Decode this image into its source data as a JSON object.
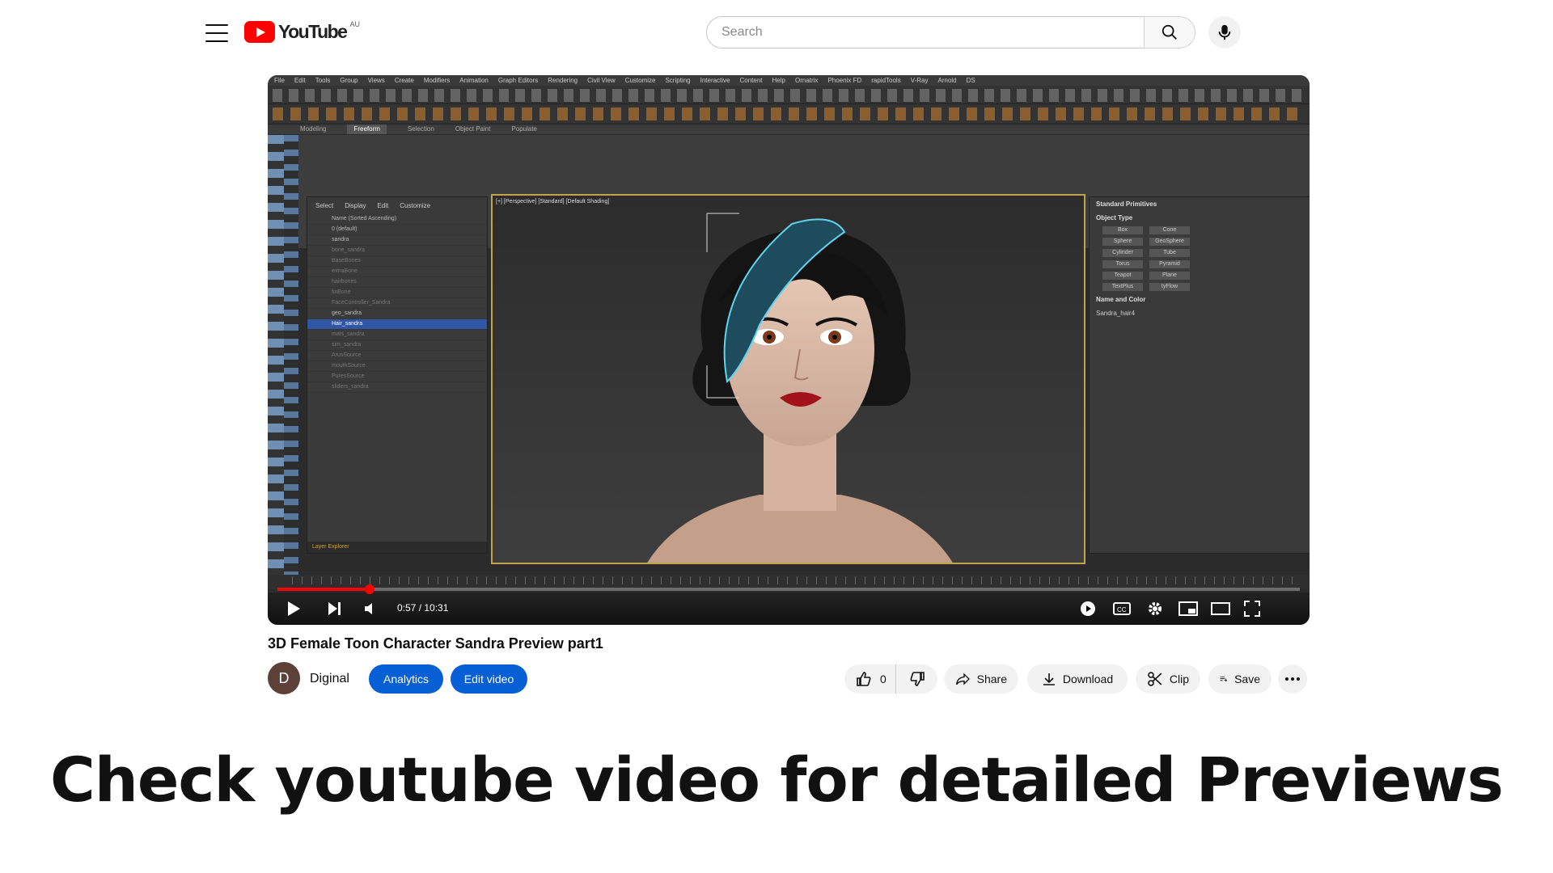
{
  "header": {
    "logo_text": "YouTube",
    "country": "AU",
    "search_placeholder": "Search"
  },
  "player": {
    "current_time": "0:57",
    "duration": "10:31",
    "time_display": "0:57 / 10:31",
    "progress_fraction": 0.09,
    "app_menu": [
      "File",
      "Edit",
      "Tools",
      "Group",
      "Views",
      "Create",
      "Modifiers",
      "Animation",
      "Graph Editors",
      "Rendering",
      "Civil View",
      "Customize",
      "Scripting",
      "Interactive",
      "Content",
      "Help",
      "Ornatrix",
      "Phoenix FD",
      "rapidTools",
      "V-Ray",
      "Arnold",
      "DS"
    ],
    "ribbon_tabs": [
      "Modeling",
      "Freeform",
      "Selection",
      "Object Paint",
      "Populate"
    ],
    "viewport_label": "[+] [Perspective] [Standard] [Default Shading]",
    "explorer_menu": [
      "Select",
      "Display",
      "Edit",
      "Customize"
    ],
    "explorer_rows": [
      "Name (Sorted Ascending)",
      "0 (default)",
      "sandra",
      "bone_sandra",
      "BaseBones",
      "extraBone",
      "hairbones",
      "fixBone",
      "FaceController_Sandra",
      "geo_sandra",
      "Hair_sandra",
      "mats_sandra",
      "sim_sandra",
      "ArusSource",
      "mouthSource",
      "PuresSource",
      "sliders_sandra"
    ],
    "explorer_footer": "Layer Explorer",
    "panel_header": "Standard Primitives",
    "object_type_label": "Object Type",
    "object_buttons": [
      "Box",
      "Cone",
      "Sphere",
      "GeoSphere",
      "Cylinder",
      "Tube",
      "Torus",
      "Pyramid",
      "Teapot",
      "Plane",
      "TextPlus",
      "tyFlow"
    ],
    "name_color_label": "Name and Color",
    "object_name": "Sandra_hair4"
  },
  "video": {
    "title": "3D Female Toon Character Sandra Preview part1",
    "channel_name": "Diginal",
    "channel_initial": "D",
    "analytics_label": "Analytics",
    "edit_label": "Edit video",
    "like_count": "0",
    "share_label": "Share",
    "download_label": "Download",
    "clip_label": "Clip",
    "save_label": "Save"
  },
  "caption": "Check youtube video for detailed Previews",
  "colors": {
    "brand_red": "#ff0000",
    "accent_blue": "#065fd4",
    "viewport_border": "#c2a24a",
    "hair": "#1e4c5c"
  }
}
